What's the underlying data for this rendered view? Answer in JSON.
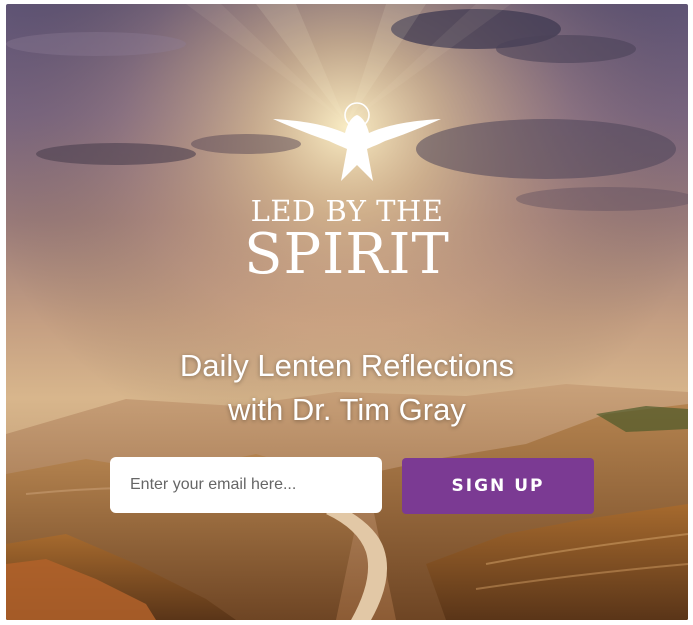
{
  "brand": {
    "logo_line1": "LED BY THE",
    "logo_line2": "SPIRIT",
    "logo_icon": "dove-icon"
  },
  "hero": {
    "headline_line1": "Daily Lenten Reflections",
    "headline_line2": "with Dr. Tim Gray"
  },
  "signup_form": {
    "email_placeholder": "Enter your email here...",
    "email_value": "",
    "button_label": "SIGN UP"
  },
  "colors": {
    "button_purple": "#7b3a93",
    "sky_purple": "#6a567a",
    "sunset_gold": "#f2c979",
    "canyon_brown": "#8a5a34",
    "text_white": "#ffffff"
  }
}
